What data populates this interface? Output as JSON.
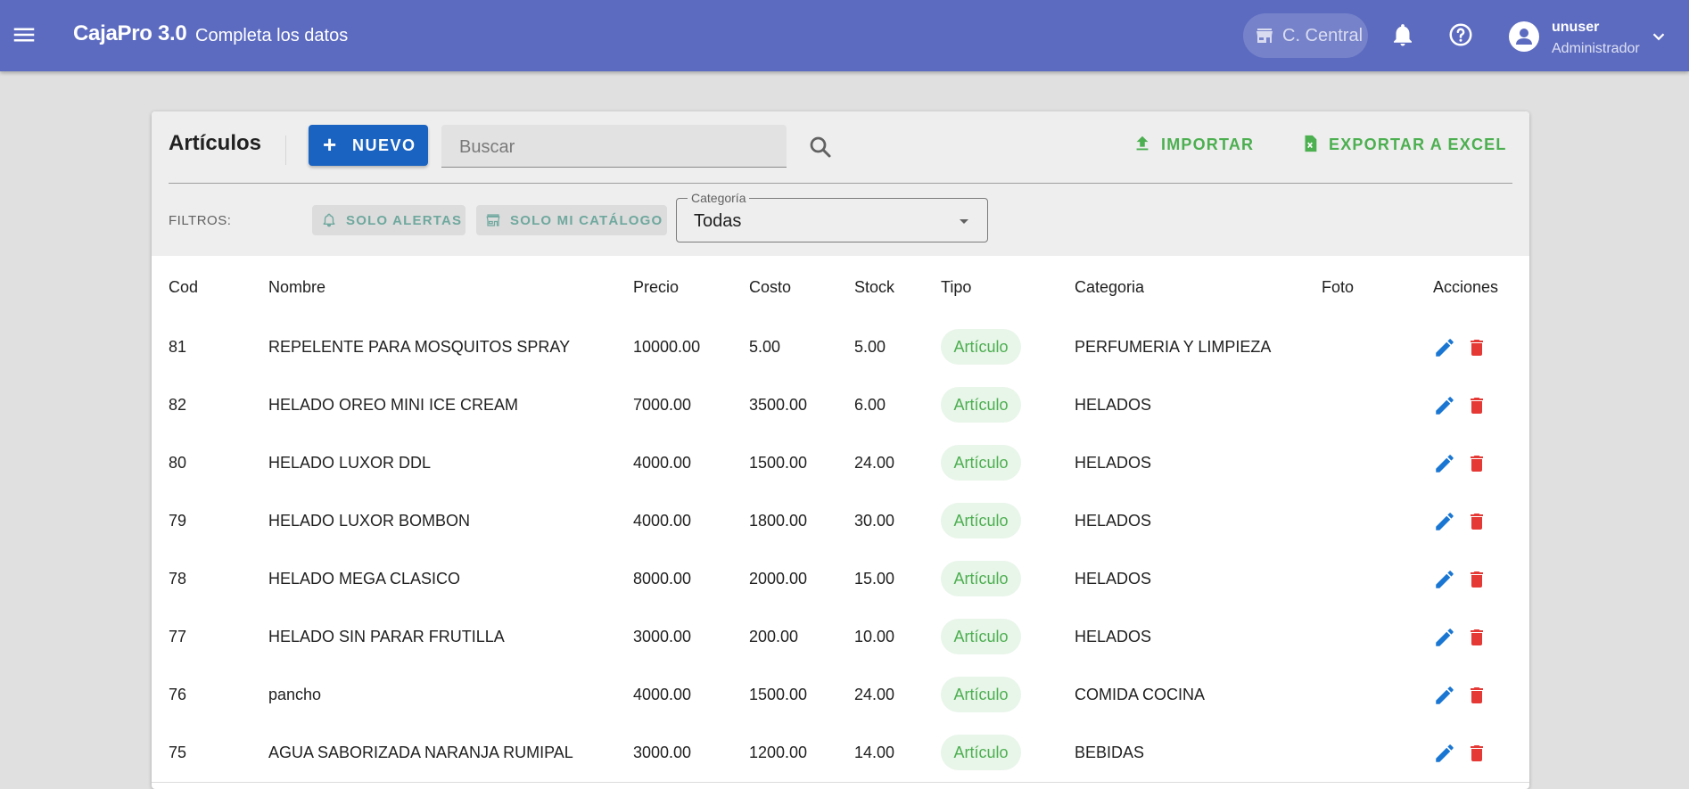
{
  "app": {
    "brand": "CajaPro 3.0",
    "subtitle": "Completa los datos",
    "branch": "C. Central",
    "user": {
      "name": "unuser",
      "role": "Administrador"
    },
    "colors": {
      "appbar": "#5c6bc0",
      "primary": "#1a63c1",
      "success": "#4caf50",
      "danger": "#e53935"
    }
  },
  "card": {
    "title": "Artículos",
    "new_button": "NUEVO",
    "new_icon": "+",
    "search_placeholder": "Buscar",
    "import_button": "IMPORTAR",
    "export_button": "EXPORTAR A EXCEL",
    "filters_label": "FILTROS:",
    "chip_alerts": "SOLO ALERTAS",
    "chip_catalog": "SOLO MI CATÁLOGO",
    "category": {
      "legend": "Categoría",
      "value": "Todas"
    }
  },
  "table": {
    "headers": {
      "cod": "Cod",
      "nombre": "Nombre",
      "precio": "Precio",
      "costo": "Costo",
      "stock": "Stock",
      "tipo": "Tipo",
      "categoria": "Categoria",
      "foto": "Foto",
      "acciones": "Acciones"
    },
    "rows": [
      {
        "cod": "81",
        "nombre": "REPELENTE PARA MOSQUITOS SPRAY",
        "precio": "10000.00",
        "costo": "5.00",
        "stock": "5.00",
        "tipo": "Artículo",
        "categoria": "PERFUMERIA Y LIMPIEZA"
      },
      {
        "cod": "82",
        "nombre": "HELADO OREO MINI ICE CREAM",
        "precio": "7000.00",
        "costo": "3500.00",
        "stock": "6.00",
        "tipo": "Artículo",
        "categoria": "HELADOS"
      },
      {
        "cod": "80",
        "nombre": "HELADO LUXOR DDL",
        "precio": "4000.00",
        "costo": "1500.00",
        "stock": "24.00",
        "tipo": "Artículo",
        "categoria": "HELADOS"
      },
      {
        "cod": "79",
        "nombre": "HELADO LUXOR BOMBON",
        "precio": "4000.00",
        "costo": "1800.00",
        "stock": "30.00",
        "tipo": "Artículo",
        "categoria": "HELADOS"
      },
      {
        "cod": "78",
        "nombre": "HELADO MEGA CLASICO",
        "precio": "8000.00",
        "costo": "2000.00",
        "stock": "15.00",
        "tipo": "Artículo",
        "categoria": "HELADOS"
      },
      {
        "cod": "77",
        "nombre": "HELADO SIN PARAR FRUTILLA",
        "precio": "3000.00",
        "costo": "200.00",
        "stock": "10.00",
        "tipo": "Artículo",
        "categoria": "HELADOS"
      },
      {
        "cod": "76",
        "nombre": "pancho",
        "precio": "4000.00",
        "costo": "1500.00",
        "stock": "24.00",
        "tipo": "Artículo",
        "categoria": "COMIDA COCINA"
      },
      {
        "cod": "75",
        "nombre": "AGUA SABORIZADA NARANJA RUMIPAL",
        "precio": "3000.00",
        "costo": "1200.00",
        "stock": "14.00",
        "tipo": "Artículo",
        "categoria": "BEBIDAS"
      }
    ]
  }
}
